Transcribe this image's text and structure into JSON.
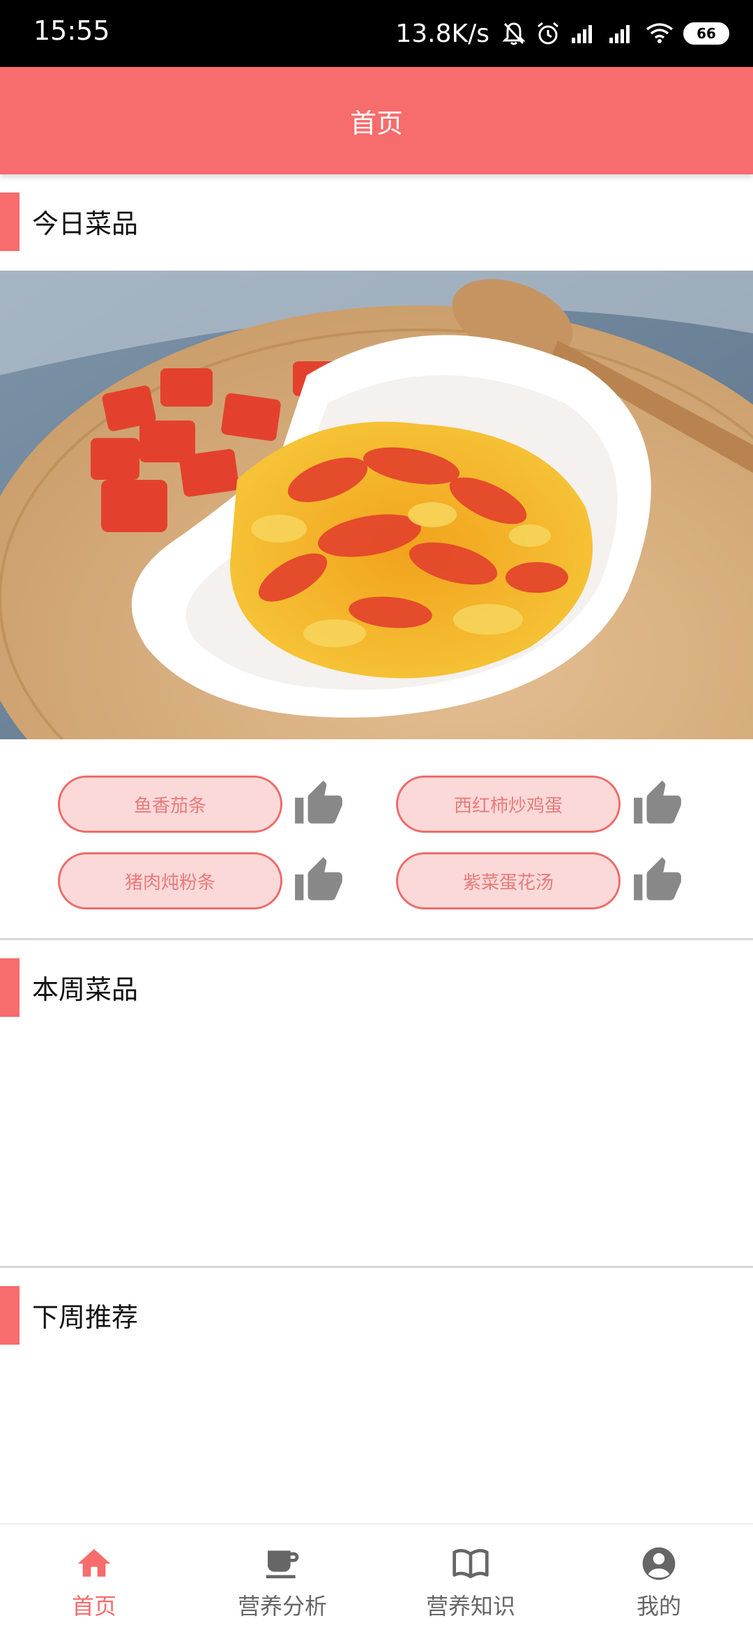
{
  "status_bar": {
    "time": "15:55",
    "net_speed": "13.8K/s",
    "battery": "66"
  },
  "header": {
    "title": "首页"
  },
  "sections": {
    "today": "今日菜品",
    "this_week": "本周菜品",
    "next_week": "下周推荐"
  },
  "dishes": [
    {
      "name": "鱼香茄条",
      "icon": "thumbs-up-icon"
    },
    {
      "name": "西红柿炒鸡蛋",
      "icon": "thumbs-up-icon"
    },
    {
      "name": "猪肉炖粉条",
      "icon": "thumbs-up-icon"
    },
    {
      "name": "紫菜蛋花汤",
      "icon": "thumbs-up-icon"
    }
  ],
  "bottom_nav": {
    "items": [
      {
        "label": "首页",
        "icon": "home-icon",
        "active": true
      },
      {
        "label": "营养分析",
        "icon": "coffee-cup-icon",
        "active": false
      },
      {
        "label": "营养知识",
        "icon": "book-icon",
        "active": false
      },
      {
        "label": "我的",
        "icon": "user-icon",
        "active": false
      }
    ]
  },
  "colors": {
    "accent": "#f76c6c",
    "pill_bg": "#fbd9d9",
    "pill_text": "#ea7a7a",
    "icon_gray": "#888888"
  }
}
